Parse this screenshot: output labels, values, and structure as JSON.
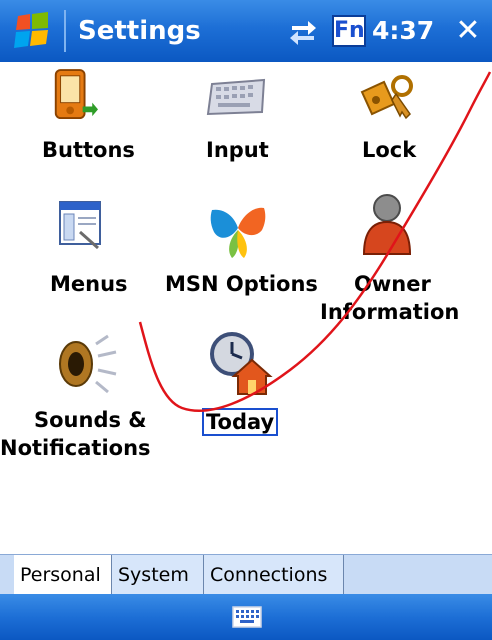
{
  "titlebar": {
    "title": "Settings",
    "fn_label": "Fn",
    "time": "4:37",
    "close_label": "✕"
  },
  "items": [
    {
      "label": "Buttons"
    },
    {
      "label": "Input"
    },
    {
      "label": "Lock"
    },
    {
      "label": "Menus"
    },
    {
      "label": "MSN Options"
    },
    {
      "label_line1": "Owner",
      "label_line2": "Information"
    },
    {
      "label_line1": "Sounds &",
      "label_line2": "Notifications"
    },
    {
      "label": "Today"
    }
  ],
  "tabs": [
    {
      "label": "Personal",
      "active": true
    },
    {
      "label": "System",
      "active": false
    },
    {
      "label": "Connections",
      "active": false
    }
  ],
  "colors": {
    "titlebar": "#1d6fd6",
    "stroke": "#e0141a",
    "focus_border": "#1a4fcf"
  }
}
